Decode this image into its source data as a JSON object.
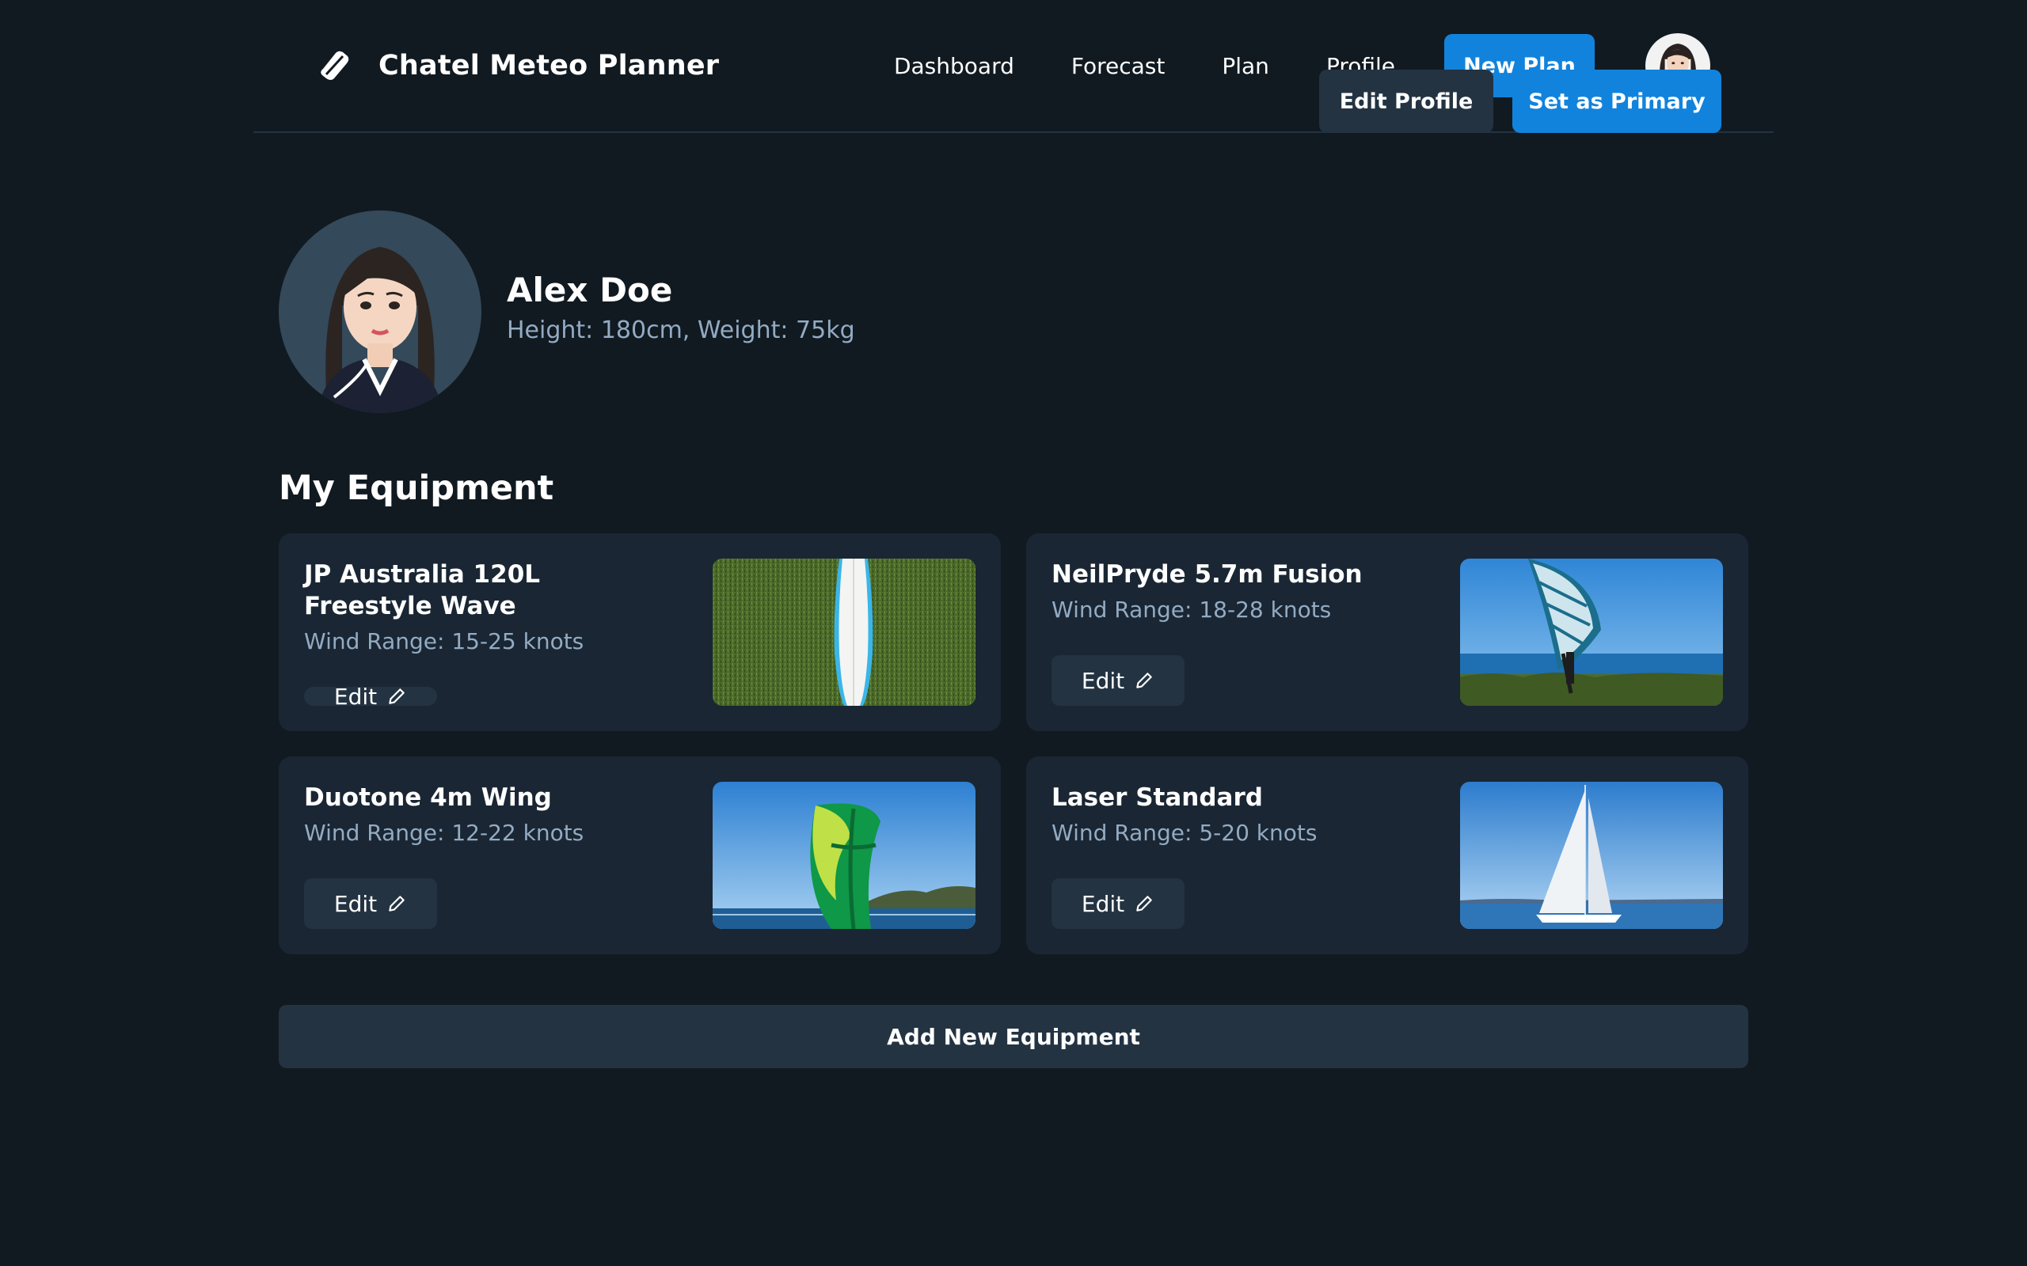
{
  "app": {
    "name": "Chatel Meteo Planner"
  },
  "nav": {
    "items": [
      "Dashboard",
      "Forecast",
      "Plan",
      "Profile"
    ],
    "new_plan_label": "New Plan"
  },
  "profile": {
    "name": "Alex Doe",
    "stats": "Height: 180cm, Weight: 75kg",
    "edit_label": "Edit Profile",
    "primary_label": "Set as Primary"
  },
  "equipment": {
    "title": "My Equipment",
    "items": [
      {
        "name": "JP Australia 120L Freestyle Wave",
        "range": "Wind Range: 15-25 knots",
        "edit_label": "Edit",
        "image": "surfboard-on-grass"
      },
      {
        "name": "NeilPryde 5.7m Fusion",
        "range": "Wind Range: 18-28 knots",
        "edit_label": "Edit",
        "image": "windsurf-sail-by-lake"
      },
      {
        "name": "Duotone 4m Wing",
        "range": "Wind Range: 12-22 knots",
        "edit_label": "Edit",
        "image": "green-wing-over-lake"
      },
      {
        "name": "Laser Standard",
        "range": "Wind Range: 5-20 knots",
        "edit_label": "Edit",
        "image": "sailboat-on-water"
      }
    ],
    "add_label": "Add New Equipment"
  },
  "icons": {
    "logo": "leaf-logo-icon",
    "edit": "pencil-icon"
  },
  "colors": {
    "background": "#111a21",
    "card": "#1a2633",
    "primary": "#1283dc",
    "secondary": "#233342",
    "muted_text": "#93abc3"
  }
}
